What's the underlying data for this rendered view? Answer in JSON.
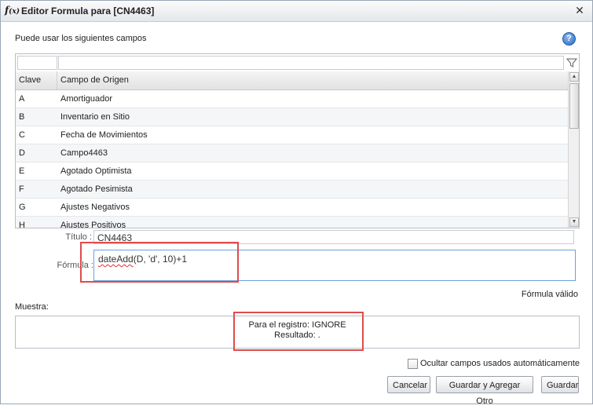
{
  "window": {
    "title": "Editor Formula para [CN4463]",
    "title_icon": "fx-icon",
    "close_glyph": "✕"
  },
  "intro_text": "Puede usar los siguientes campos",
  "help_glyph": "?",
  "grid": {
    "columns": [
      "Clave",
      "Campo de Origen"
    ],
    "rows": [
      {
        "key": "A",
        "value": "Amortiguador"
      },
      {
        "key": "B",
        "value": "Inventario en Sitio"
      },
      {
        "key": "C",
        "value": "Fecha de Movimientos"
      },
      {
        "key": "D",
        "value": "Campo4463"
      },
      {
        "key": "E",
        "value": "Agotado Optimista"
      },
      {
        "key": "F",
        "value": "Agotado Pesimista"
      },
      {
        "key": "G",
        "value": "Ajustes Negativos"
      },
      {
        "key": "H",
        "value": "Ajustes Positivos"
      }
    ]
  },
  "form": {
    "titulo_label": "Título :",
    "titulo_value": "CN4463",
    "formula_label": "Fórmula :",
    "formula_func": "dateAdd",
    "formula_rest": "(D, 'd', 10)+1",
    "formula_status": "Fórmula válido"
  },
  "sample": {
    "label": "Muestra:",
    "line1": "Para el registro: IGNORE",
    "line2": "Resultado: ."
  },
  "options": {
    "hide_used_fields_label": "Ocultar campos usados automáticamente",
    "hide_used_fields_checked": false
  },
  "buttons": {
    "cancel": "Cancelar",
    "save_and_add": "Guardar y Agregar Otro",
    "save": "Guardar"
  },
  "colors": {
    "highlight": "#e04b4b",
    "accent": "#6aa0dc"
  }
}
